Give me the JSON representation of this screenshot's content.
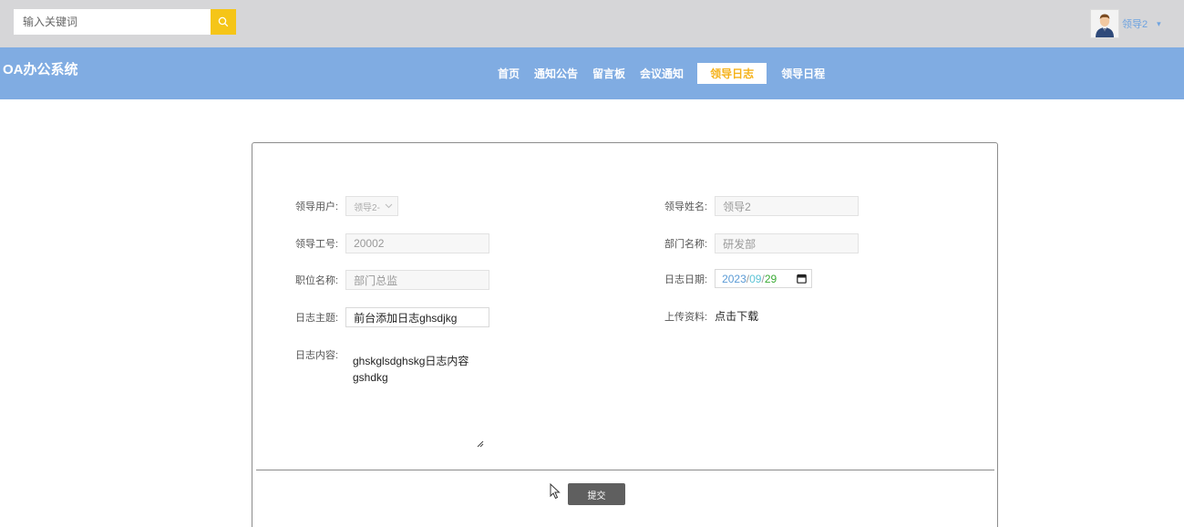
{
  "search": {
    "placeholder": "输入关键词"
  },
  "user": {
    "name": "领导2",
    "caret": "▾"
  },
  "header": {
    "logo": "OA办公系统"
  },
  "nav": {
    "items": [
      "首页",
      "通知公告",
      "留言板",
      "会议通知",
      "领导日志",
      "领导日程"
    ],
    "active_index": 4
  },
  "form": {
    "leader_user": {
      "label": "领导用户:",
      "value": "领导2-"
    },
    "leader_name": {
      "label": "领导姓名:",
      "value": "领导2"
    },
    "leader_no": {
      "label": "领导工号:",
      "value": "20002"
    },
    "dept_name": {
      "label": "部门名称:",
      "value": "研发部"
    },
    "position": {
      "label": "职位名称:",
      "value": "部门总监"
    },
    "log_date": {
      "label": "日志日期:",
      "year": "2023",
      "month": "09",
      "day": "29",
      "sep": "/"
    },
    "log_subject": {
      "label": "日志主题:",
      "value": "前台添加日志ghsdjkg"
    },
    "upload": {
      "label": "上传资料:",
      "link": "点击下载"
    },
    "log_content": {
      "label": "日志内容:",
      "line1": "ghskglsdghskg日志内容",
      "line2": "gshdkg"
    },
    "submit_label": "提交"
  },
  "colors": {
    "topbar": "#d6d6d8",
    "navbar": "#80ace2",
    "accent": "#f5c518",
    "active_nav_text": "#f5b21a",
    "submit": "#5f5f5f"
  }
}
